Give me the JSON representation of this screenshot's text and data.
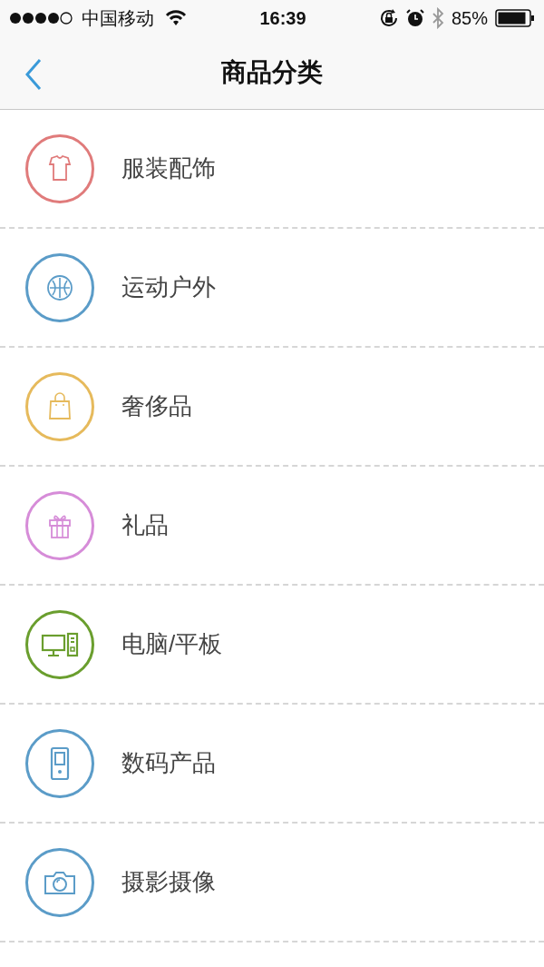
{
  "status_bar": {
    "carrier": "中国移动",
    "time": "16:39",
    "battery": "85%"
  },
  "nav": {
    "title": "商品分类"
  },
  "categories": [
    {
      "label": "服装配饰",
      "kind": "shirt",
      "color": "#e07b7b"
    },
    {
      "label": "运动户外",
      "kind": "ball",
      "color": "#5b9cc8"
    },
    {
      "label": "奢侈品",
      "kind": "bag",
      "color": "#e6ba5c"
    },
    {
      "label": "礼品",
      "kind": "gift",
      "color": "#d68cd8"
    },
    {
      "label": "电脑/平板",
      "kind": "computer",
      "color": "#6a9e2e"
    },
    {
      "label": "数码产品",
      "kind": "phone",
      "color": "#5b9cc8"
    },
    {
      "label": "摄影摄像",
      "kind": "camera",
      "color": "#5b9cc8"
    }
  ]
}
